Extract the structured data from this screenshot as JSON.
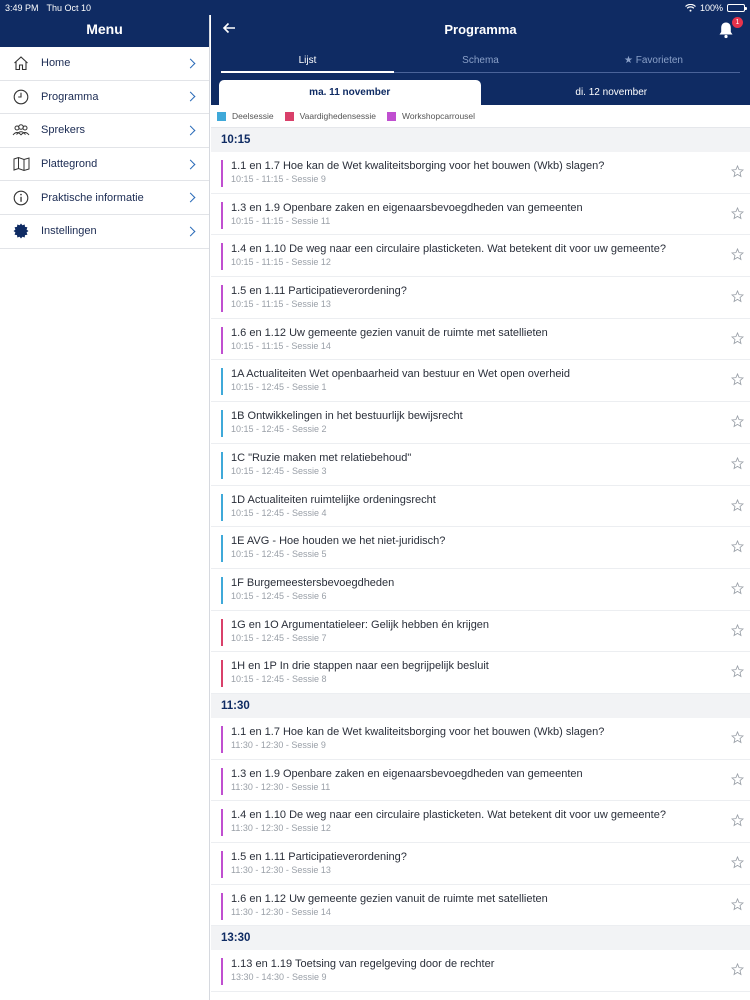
{
  "status": {
    "time": "3:49 PM",
    "date": "Thu Oct 10",
    "battery": "100%"
  },
  "sidebar": {
    "title": "Menu",
    "items": [
      {
        "label": "Home",
        "icon": "home-icon"
      },
      {
        "label": "Programma",
        "icon": "clock-icon"
      },
      {
        "label": "Sprekers",
        "icon": "people-icon"
      },
      {
        "label": "Plattegrond",
        "icon": "map-icon"
      },
      {
        "label": "Praktische informatie",
        "icon": "info-icon"
      },
      {
        "label": "Instellingen",
        "icon": "gear-icon"
      }
    ]
  },
  "header": {
    "title": "Programma",
    "back_icon": "back-arrow-icon",
    "notifications": "1"
  },
  "tabs": {
    "list": "Lijst",
    "schedule": "Schema",
    "favorites": "★ Favorieten"
  },
  "dates": {
    "day1": "ma. 11 november",
    "day2": "di. 12 november"
  },
  "legend": [
    {
      "label": "Deelsessie",
      "color": "#3fa9d9"
    },
    {
      "label": "Vaardighedensessie",
      "color": "#d9406a"
    },
    {
      "label": "Workshopcarrousel",
      "color": "#c04fd0"
    }
  ],
  "colors": {
    "deelsessie": "#3fa9d9",
    "vaardigheden": "#d9406a",
    "workshop": "#c04fd0",
    "primary": "#0f2b63"
  },
  "sections": [
    {
      "time": "10:15",
      "sessions": [
        {
          "title": "1.1 en 1.7 Hoe kan de Wet kwaliteitsborging voor het bouwen (Wkb) slagen?",
          "sub": "10:15 - 11:15 - Sessie 9",
          "type": "workshop"
        },
        {
          "title": "1.3 en 1.9 Openbare zaken en eigenaarsbevoegdheden van gemeenten",
          "sub": "10:15 - 11:15 - Sessie 11",
          "type": "workshop"
        },
        {
          "title": "1.4 en 1.10 De weg naar een circulaire plasticketen. Wat betekent dit voor uw gemeente?",
          "sub": "10:15 - 11:15 - Sessie 12",
          "type": "workshop"
        },
        {
          "title": "1.5 en 1.11 Participatieverordening?",
          "sub": "10:15 - 11:15 - Sessie 13",
          "type": "workshop"
        },
        {
          "title": "1.6 en 1.12 Uw gemeente gezien vanuit de ruimte met satellieten",
          "sub": "10:15 - 11:15 - Sessie 14",
          "type": "workshop"
        },
        {
          "title": "1A Actualiteiten Wet openbaarheid van bestuur en Wet open overheid",
          "sub": "10:15 - 12:45 - Sessie 1",
          "type": "deelsessie"
        },
        {
          "title": "1B Ontwikkelingen in het bestuurlijk bewijsrecht",
          "sub": "10:15 - 12:45 - Sessie 2",
          "type": "deelsessie"
        },
        {
          "title": "1C \"Ruzie maken met relatiebehoud\"",
          "sub": "10:15 - 12:45 - Sessie 3",
          "type": "deelsessie"
        },
        {
          "title": "1D Actualiteiten ruimtelijke ordeningsrecht",
          "sub": "10:15 - 12:45 - Sessie 4",
          "type": "deelsessie"
        },
        {
          "title": "1E AVG - Hoe houden we het niet-juridisch?",
          "sub": "10:15 - 12:45 - Sessie 5",
          "type": "deelsessie"
        },
        {
          "title": "1F Burgemeestersbevoegdheden",
          "sub": "10:15 - 12:45 - Sessie 6",
          "type": "deelsessie"
        },
        {
          "title": "1G en 1O Argumentatieleer: Gelijk hebben én krijgen",
          "sub": "10:15 - 12:45 - Sessie 7",
          "type": "vaardigheden"
        },
        {
          "title": "1H en 1P In drie stappen naar een begrijpelijk besluit",
          "sub": "10:15 - 12:45 - Sessie 8",
          "type": "vaardigheden"
        }
      ]
    },
    {
      "time": "11:30",
      "sessions": [
        {
          "title": "1.1 en 1.7 Hoe kan de Wet kwaliteitsborging voor het bouwen (Wkb) slagen?",
          "sub": "11:30 - 12:30 - Sessie 9",
          "type": "workshop"
        },
        {
          "title": "1.3 en 1.9 Openbare zaken en eigenaarsbevoegdheden van gemeenten",
          "sub": "11:30 - 12:30 - Sessie 11",
          "type": "workshop"
        },
        {
          "title": "1.4 en 1.10 De weg naar een circulaire plasticketen. Wat betekent dit voor uw gemeente?",
          "sub": "11:30 - 12:30 - Sessie 12",
          "type": "workshop"
        },
        {
          "title": "1.5 en 1.11 Participatieverordening?",
          "sub": "11:30 - 12:30 - Sessie 13",
          "type": "workshop"
        },
        {
          "title": "1.6 en 1.12 Uw gemeente gezien vanuit de ruimte met satellieten",
          "sub": "11:30 - 12:30 - Sessie 14",
          "type": "workshop"
        }
      ]
    },
    {
      "time": "13:30",
      "sessions": [
        {
          "title": "1.13 en 1.19 Toetsing van regelgeving door de rechter",
          "sub": "13:30 - 14:30 - Sessie 9",
          "type": "workshop"
        }
      ]
    }
  ]
}
